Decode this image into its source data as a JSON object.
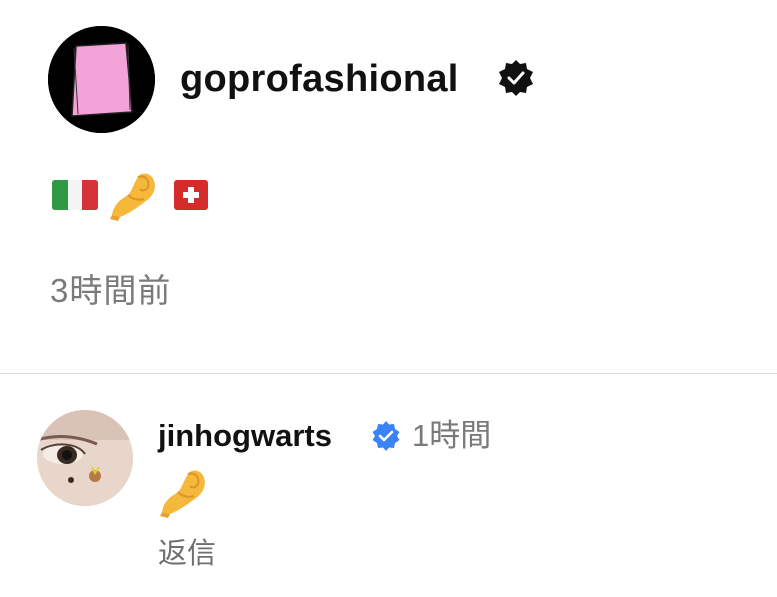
{
  "post": {
    "username": "goprofashional",
    "verified_badge_icon": "verified-badge-black",
    "caption_icons": [
      "italy-flag-icon",
      "pinched-fingers-emoji",
      "switzerland-flag-icon"
    ],
    "timestamp": "3時間前"
  },
  "comment": {
    "username": "jinhogwarts",
    "verified_badge_icon": "verified-badge-blue",
    "time": "1時間",
    "body_icon": "pinched-fingers-emoji",
    "reply_label": "返信"
  },
  "colors": {
    "avatar_pink": "#f3a3d8",
    "verified_blue": "#3b82f6",
    "muted_text": "#7a7a7a"
  }
}
